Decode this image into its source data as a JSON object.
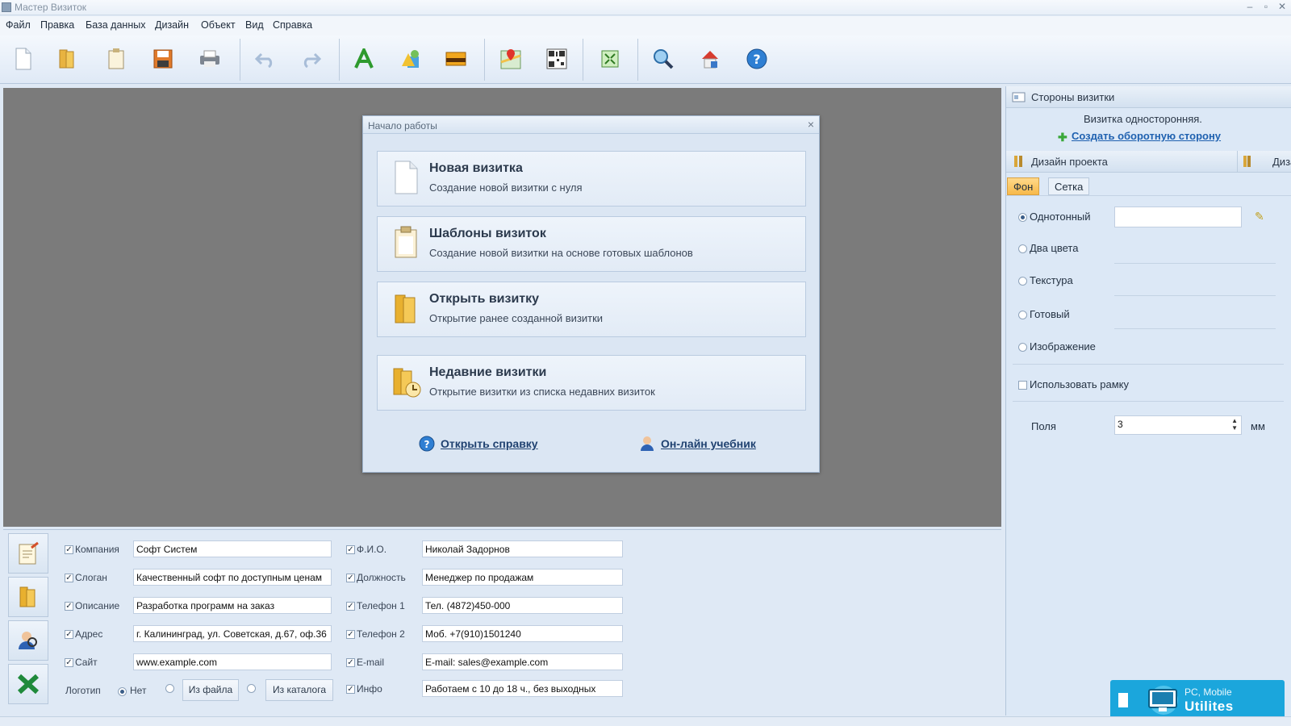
{
  "window": {
    "title": "Мастер Визиток",
    "minimize": "–",
    "maximize": "▫",
    "close": "✕"
  },
  "menu": [
    "Файл",
    "Правка",
    "База данных",
    "Дизайн",
    "Объект",
    "Вид",
    "Справка"
  ],
  "toolbar_icons": [
    "new-file-icon",
    "open-folder-icon",
    "templates-icon",
    "save-icon",
    "print-icon",
    "undo-icon",
    "redo-icon",
    "text-icon",
    "shapes-icon",
    "image-icon",
    "map-icon",
    "qr-code-icon",
    "fit-icon",
    "zoom-icon",
    "publish-icon",
    "help-icon"
  ],
  "dialog": {
    "title": "Начало работы",
    "close": "×",
    "options": [
      {
        "title": "Новая визитка",
        "subtitle": "Создание новой визитки с нуля",
        "icon": "blank-page-icon"
      },
      {
        "title": "Шаблоны визиток",
        "subtitle": "Создание новой визитки на основе готовых шаблонов",
        "icon": "clipboard-icon"
      },
      {
        "title": "Открыть визитку",
        "subtitle": "Открытие ранее созданной визитки",
        "icon": "folder-icon"
      },
      {
        "title": "Недавние визитки",
        "subtitle": "Открытие визитки из списка недавних визиток",
        "icon": "recent-folder-icon"
      }
    ],
    "help_link": "Открыть справку",
    "tutorial_link": "Он-лайн учебник"
  },
  "right_panel": {
    "sides_header": "Стороны визитки",
    "sides_text": "Визитка односторонняя.",
    "sides_link": "Создать оборотную сторону",
    "design_header": "Дизайн проекта",
    "design_header_cut": "Диза",
    "tabs": [
      "Фон",
      "Сетка"
    ],
    "background_options": [
      {
        "label": "Однотонный",
        "selected": true
      },
      {
        "label": "Два цвета",
        "selected": false
      },
      {
        "label": "Текстура",
        "selected": false
      },
      {
        "label": "Готовый",
        "selected": false
      },
      {
        "label": "Изображение",
        "selected": false
      }
    ],
    "use_frame_label": "Использовать рамку",
    "use_frame_checked": false,
    "margins_label": "Поля",
    "margins_value": "3",
    "margins_unit": "мм"
  },
  "fields_left": [
    {
      "label": "Компания",
      "value": "Софт Систем",
      "checked": true
    },
    {
      "label": "Слоган",
      "value": "Качественный софт по доступным ценам",
      "checked": true
    },
    {
      "label": "Описание",
      "value": "Разработка программ на заказ",
      "checked": true
    },
    {
      "label": "Адрес",
      "value": "г. Калининград, ул. Советская, д.67, оф.36",
      "checked": true
    },
    {
      "label": "Сайт",
      "value": "www.example.com",
      "checked": true
    }
  ],
  "logo": {
    "label": "Логотип",
    "options": [
      "Нет",
      "Из файла",
      "Из каталога"
    ],
    "selected": "Нет"
  },
  "fields_right": [
    {
      "label": "Ф.И.О.",
      "value": "Николай Задорнов",
      "checked": true
    },
    {
      "label": "Должность",
      "value": "Менеджер по продажам",
      "checked": true
    },
    {
      "label": "Телефон 1",
      "value": "Тел. (4872)450-000",
      "checked": true
    },
    {
      "label": "Телефон 2",
      "value": "Моб. +7(910)1501240",
      "checked": true
    },
    {
      "label": "E-mail",
      "value": "E-mail: sales@example.com",
      "checked": true
    },
    {
      "label": "Инфо",
      "value": "Работаем с 10 до 18 ч., без выходных",
      "checked": true
    }
  ],
  "watermark": {
    "line1": "PC, Mobile",
    "line2": "Utilites"
  },
  "colors": {
    "accent_tab": "#f7b94a",
    "canvas": "#7b7b7b",
    "panel": "#dce8f6",
    "watermark": "#1ba6dc"
  }
}
